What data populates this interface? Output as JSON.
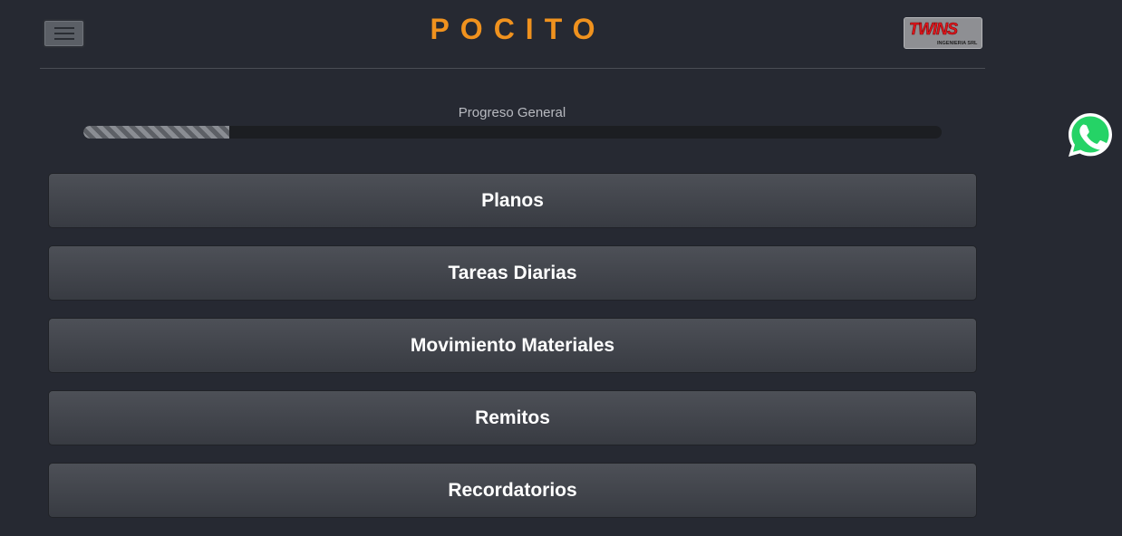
{
  "header": {
    "title": "POCITO",
    "menu_icon": "hamburger-menu-icon",
    "logo": {
      "name": "TWINS",
      "subtitle": "INGENIERIA SRL"
    }
  },
  "progress": {
    "label": "Progreso General",
    "fraction": 0.17
  },
  "menu_items": [
    {
      "label": "Planos"
    },
    {
      "label": "Tareas Diarias"
    },
    {
      "label": "Movimiento Materiales"
    },
    {
      "label": "Remitos"
    },
    {
      "label": "Recordatorios"
    }
  ],
  "whatsapp": {
    "icon": "whatsapp-icon"
  },
  "colors": {
    "accent": "#f0921e",
    "background": "#262932",
    "whatsapp_green": "#25d366"
  }
}
